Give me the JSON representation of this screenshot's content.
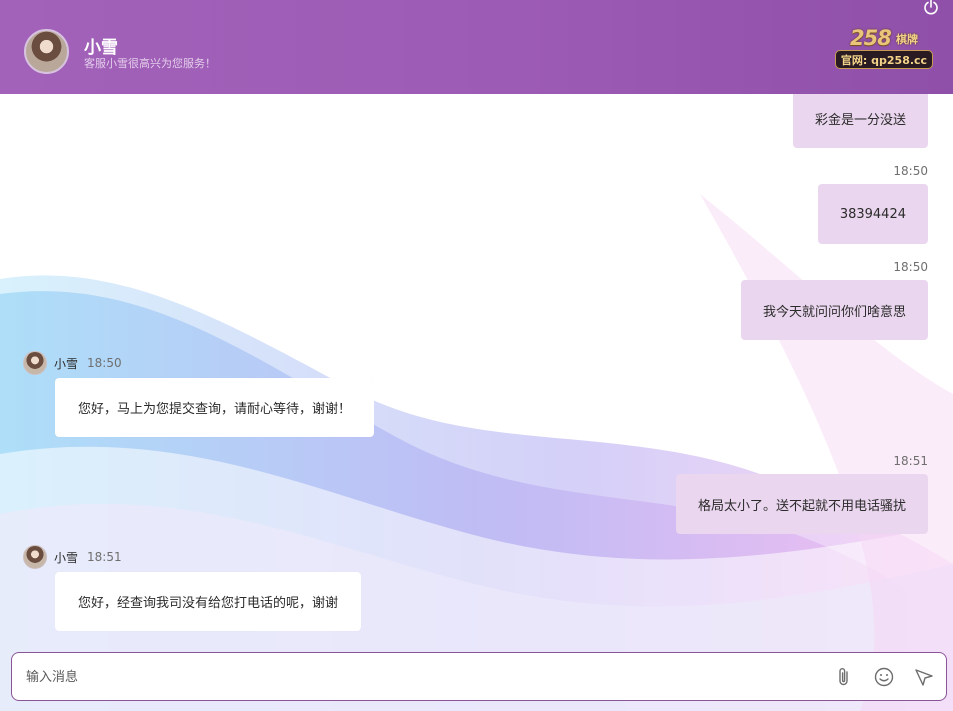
{
  "header": {
    "agent_name": "小雪",
    "agent_subtitle": "客服小雪很高兴为您服务！",
    "logo_number": "258",
    "logo_brand": "棋牌",
    "logo_site": "官网: qp258.cc"
  },
  "messages": [
    {
      "side": "right",
      "time": "",
      "text": "彩金是一分没送"
    },
    {
      "side": "right",
      "time": "18:50",
      "text": "38394424"
    },
    {
      "side": "right",
      "time": "18:50",
      "text": "我今天就问问你们啥意思"
    },
    {
      "side": "left",
      "sender": "小雪",
      "time": "18:50",
      "text": "您好，马上为您提交查询，请耐心等待，谢谢！"
    },
    {
      "side": "right",
      "time": "18:51",
      "text": "格局太小了。送不起就不用电话骚扰"
    },
    {
      "side": "left",
      "sender": "小雪",
      "time": "18:51",
      "text": "您好，经查询我司没有给您打电话的呢，谢谢"
    }
  ],
  "input": {
    "placeholder": "输入消息",
    "value": ""
  },
  "icons": {
    "power": "power-icon",
    "attach": "paperclip-icon",
    "emoji": "smiley-icon",
    "send": "send-icon"
  },
  "colors": {
    "header_bg": "#9c5bb5",
    "bubble_right": "#ead6ee",
    "bubble_left": "#ffffff",
    "input_border": "#8a5596"
  }
}
